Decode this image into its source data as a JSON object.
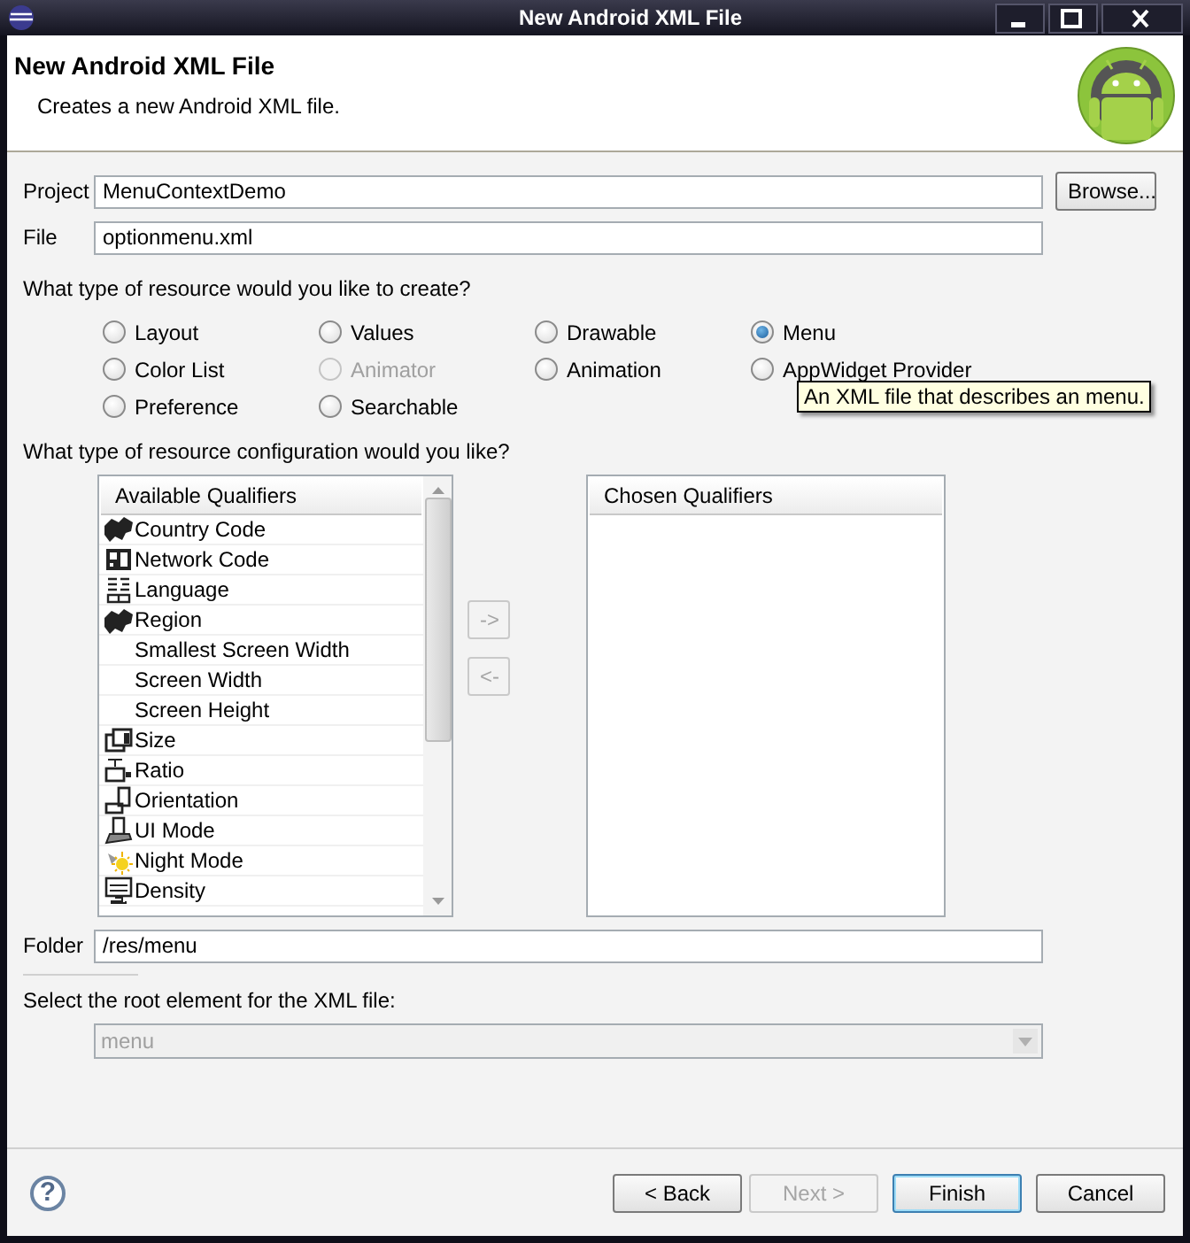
{
  "window": {
    "title": "New Android XML File"
  },
  "header": {
    "title": "New Android XML File",
    "description": "Creates a new Android XML file."
  },
  "project": {
    "label": "Project",
    "value": "MenuContextDemo",
    "button": "Browse..."
  },
  "file": {
    "label": "File",
    "value": "optionmenu.xml"
  },
  "resource_type": {
    "prompt": "What type of resource would you like to create?",
    "options": [
      {
        "label": "Layout",
        "selected": false,
        "disabled": false
      },
      {
        "label": "Values",
        "selected": false,
        "disabled": false
      },
      {
        "label": "Drawable",
        "selected": false,
        "disabled": false
      },
      {
        "label": "Menu",
        "selected": true,
        "disabled": false
      },
      {
        "label": "Color List",
        "selected": false,
        "disabled": false
      },
      {
        "label": "Animator",
        "selected": false,
        "disabled": true
      },
      {
        "label": "Animation",
        "selected": false,
        "disabled": false
      },
      {
        "label": "AppWidget Provider",
        "selected": false,
        "disabled": false
      },
      {
        "label": "Preference",
        "selected": false,
        "disabled": false
      },
      {
        "label": "Searchable",
        "selected": false,
        "disabled": false
      }
    ],
    "tooltip": "An XML file that describes an menu."
  },
  "configuration": {
    "prompt": "What type of resource configuration would you like?",
    "available": {
      "heading": "Available Qualifiers",
      "items": [
        {
          "label": "Country Code"
        },
        {
          "label": "Network Code"
        },
        {
          "label": "Language"
        },
        {
          "label": "Region"
        },
        {
          "label": "Smallest Screen Width"
        },
        {
          "label": "Screen Width"
        },
        {
          "label": "Screen Height"
        },
        {
          "label": "Size"
        },
        {
          "label": "Ratio"
        },
        {
          "label": "Orientation"
        },
        {
          "label": "UI Mode"
        },
        {
          "label": "Night Mode"
        },
        {
          "label": "Density"
        }
      ]
    },
    "add_button": {
      "label": "->",
      "disabled": true
    },
    "remove_button": {
      "label": "<-",
      "disabled": true
    },
    "chosen": {
      "heading": "Chosen Qualifiers"
    }
  },
  "folder": {
    "label": "Folder",
    "value": "/res/menu"
  },
  "root_element": {
    "prompt": "Select the root element for the XML file:",
    "value": "menu",
    "disabled": true
  },
  "footer": {
    "help": "?",
    "buttons": [
      {
        "label": "< Back",
        "disabled": false,
        "default": false
      },
      {
        "label": "Next >",
        "disabled": true,
        "default": false
      },
      {
        "label": "Finish",
        "disabled": false,
        "default": true
      },
      {
        "label": "Cancel",
        "disabled": false,
        "default": false
      }
    ]
  }
}
